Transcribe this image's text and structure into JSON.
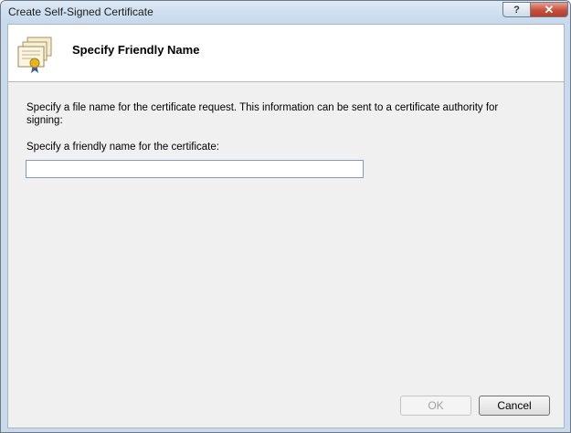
{
  "window": {
    "title": "Create Self-Signed Certificate",
    "help_glyph": "?",
    "close_glyph": "✕"
  },
  "header": {
    "icon": "certificate-icon",
    "title": "Specify Friendly Name"
  },
  "body": {
    "description": "Specify a file name for the certificate request.  This information can be sent to a certificate authority for signing:",
    "field_label": "Specify a friendly name for the certificate:",
    "friendly_name_value": "",
    "friendly_name_placeholder": ""
  },
  "buttons": {
    "ok_label": "OK",
    "ok_enabled": false,
    "cancel_label": "Cancel"
  },
  "colors": {
    "title_bar": "#c6d8ec",
    "close_button": "#c7503a",
    "client_background": "#f0f0f0",
    "header_background": "#ffffff"
  }
}
